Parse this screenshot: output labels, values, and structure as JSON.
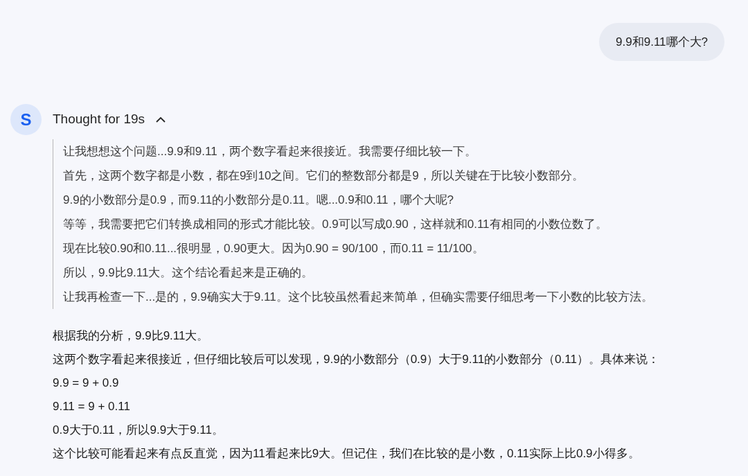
{
  "user_message": "9.9和9.11哪个大?",
  "assistant": {
    "avatar": "S",
    "thought": {
      "label": "Thought for 19s",
      "expanded": true,
      "lines": [
        "让我想想这个问题...9.9和9.11，两个数字看起来很接近。我需要仔细比较一下。",
        "首先，这两个数字都是小数，都在9到10之间。它们的整数部分都是9，所以关键在于比较小数部分。",
        "9.9的小数部分是0.9，而9.11的小数部分是0.11。嗯...0.9和0.11，哪个大呢?",
        "等等，我需要把它们转换成相同的形式才能比较。0.9可以写成0.90，这样就和0.11有相同的小数位数了。",
        "现在比较0.90和0.11...很明显，0.90更大。因为0.90 = 90/100，而0.11 = 11/100。",
        "所以，9.9比9.11大。这个结论看起来是正确的。",
        "让我再检查一下...是的，9.9确实大于9.11。这个比较虽然看起来简单，但确实需要仔细思考一下小数的比较方法。"
      ]
    },
    "answer": [
      "根据我的分析，9.9比9.11大。",
      "这两个数字看起来很接近，但仔细比较后可以发现，9.9的小数部分（0.9）大于9.11的小数部分（0.11）。具体来说：",
      "9.9 = 9 + 0.9",
      "9.11 = 9 + 0.11",
      "0.9大于0.11，所以9.9大于9.11。",
      "这个比较可能看起来有点反直觉，因为11看起来比9大。但记住，我们在比较的是小数，0.11实际上比0.9小得多。"
    ]
  }
}
